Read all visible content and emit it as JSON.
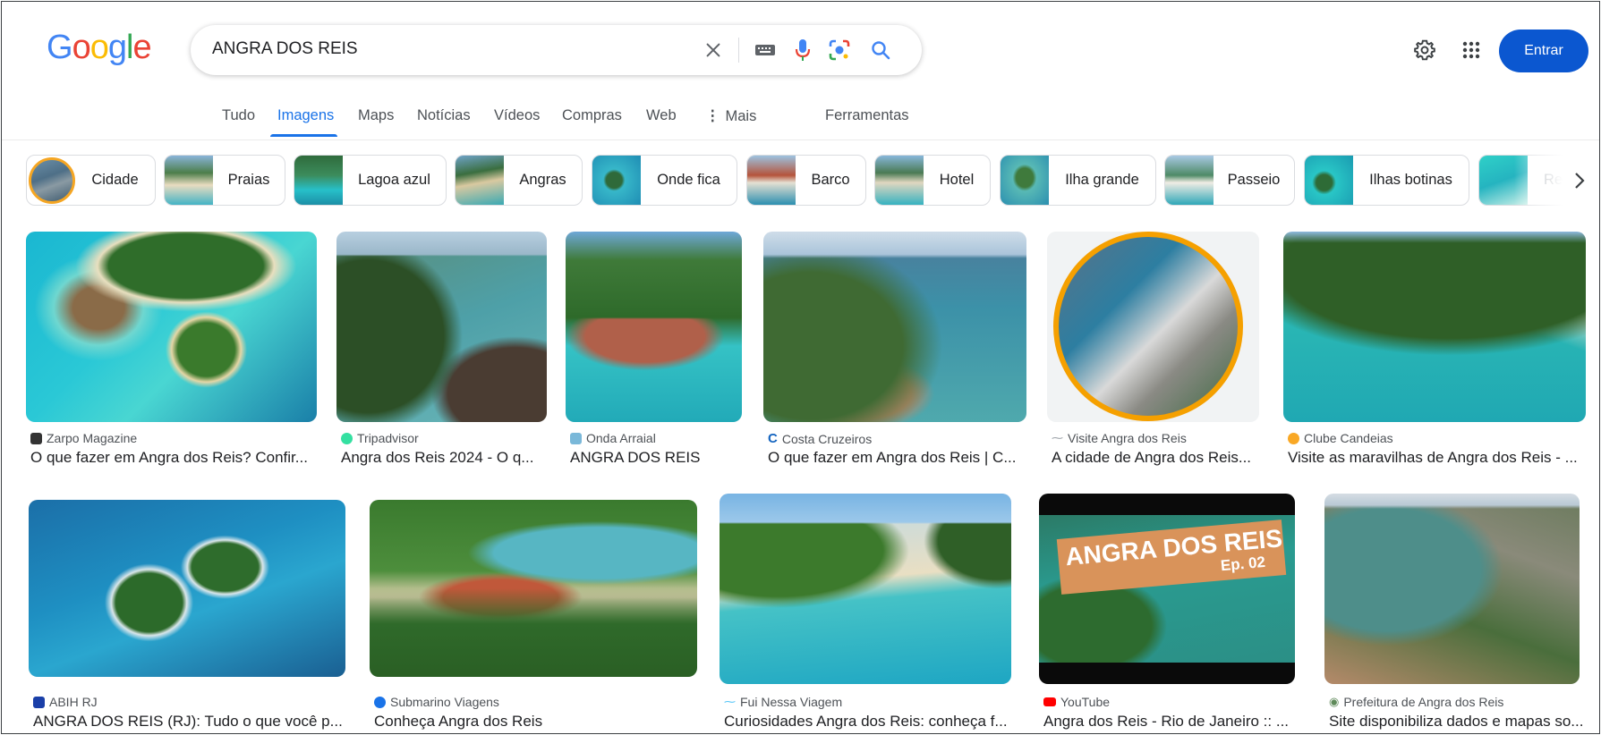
{
  "header": {
    "logo_letters": [
      {
        "ch": "G",
        "color": "#4285f4"
      },
      {
        "ch": "o",
        "color": "#ea4335"
      },
      {
        "ch": "o",
        "color": "#fbbc05"
      },
      {
        "ch": "g",
        "color": "#4285f4"
      },
      {
        "ch": "l",
        "color": "#34a853"
      },
      {
        "ch": "e",
        "color": "#ea4335"
      }
    ],
    "query": "ANGRA DOS REIS",
    "signin_label": "Entrar"
  },
  "tabs": [
    {
      "label": "Tudo"
    },
    {
      "label": "Imagens",
      "active": true
    },
    {
      "label": "Maps"
    },
    {
      "label": "Notícias"
    },
    {
      "label": "Vídeos"
    },
    {
      "label": "Compras"
    },
    {
      "label": "Web"
    },
    {
      "label": "Mais"
    },
    {
      "label": "Ferramentas"
    }
  ],
  "chips": [
    {
      "label": "Cidade",
      "icon": "city-thumbnail"
    },
    {
      "label": "Praias",
      "icon": "beach-thumbnail"
    },
    {
      "label": "Lagoa azul",
      "icon": "lagoon-thumbnail"
    },
    {
      "label": "Angras",
      "icon": "bay-thumbnail"
    },
    {
      "label": "Onde fica",
      "icon": "island-thumbnail"
    },
    {
      "label": "Barco",
      "icon": "boat-thumbnail"
    },
    {
      "label": "Hotel",
      "icon": "hotel-thumbnail"
    },
    {
      "label": "Ilha grande",
      "icon": "island-thumbnail"
    },
    {
      "label": "Passeio",
      "icon": "tour-thumbnail"
    },
    {
      "label": "Ilhas botinas",
      "icon": "islands-thumbnail"
    },
    {
      "label": "Re",
      "icon": "reef-thumbnail"
    }
  ],
  "results": [
    {
      "source": "Zarpo Magazine",
      "title": "O que fazer em Angra dos Reis? Confir...",
      "fav_color": "#333333"
    },
    {
      "source": "Tripadvisor",
      "title": "Angra dos Reis 2024 - O q...",
      "fav_color": "#34e0a1"
    },
    {
      "source": "Onda Arraial",
      "title": "ANGRA DOS REIS",
      "fav_color": "#7ab8d9"
    },
    {
      "source": "Costa Cruzeiros",
      "title": "O que fazer em Angra dos Reis | C...",
      "fav_color": "#1565c0"
    },
    {
      "source": "Visite Angra dos Reis",
      "title": "A cidade de Angra dos Reis...",
      "fav_color": "#9aa0a6"
    },
    {
      "source": "Clube Candeias",
      "title": "Visite as maravilhas de Angra dos Reis - ...",
      "fav_color": "#f9a825"
    },
    {
      "source": "ABIH RJ",
      "title": "ANGRA DOS REIS (RJ): Tudo o que você p...",
      "fav_color": "#1a3fa8"
    },
    {
      "source": "Submarino Viagens",
      "title": "Conheça Angra dos Reis",
      "fav_color": "#1a73e8"
    },
    {
      "source": "Fui Nessa Viagem",
      "title": "Curiosidades Angra dos Reis: conheça f...",
      "fav_color": "#4fc3f7"
    },
    {
      "source": "YouTube",
      "title": "Angra dos Reis - Rio de Janeiro :: ...",
      "fav_color": "#ff0000"
    },
    {
      "source": "Prefeitura de Angra dos Reis",
      "title": "Site disponibiliza dados e mapas so...",
      "fav_color": "#5f8a5a"
    }
  ],
  "video_overlay": {
    "line1": "ANGRA DOS REIS",
    "line2": "Ep. 02"
  },
  "colors": {
    "accent": "#1a73e8",
    "signin": "#0b57d0"
  }
}
